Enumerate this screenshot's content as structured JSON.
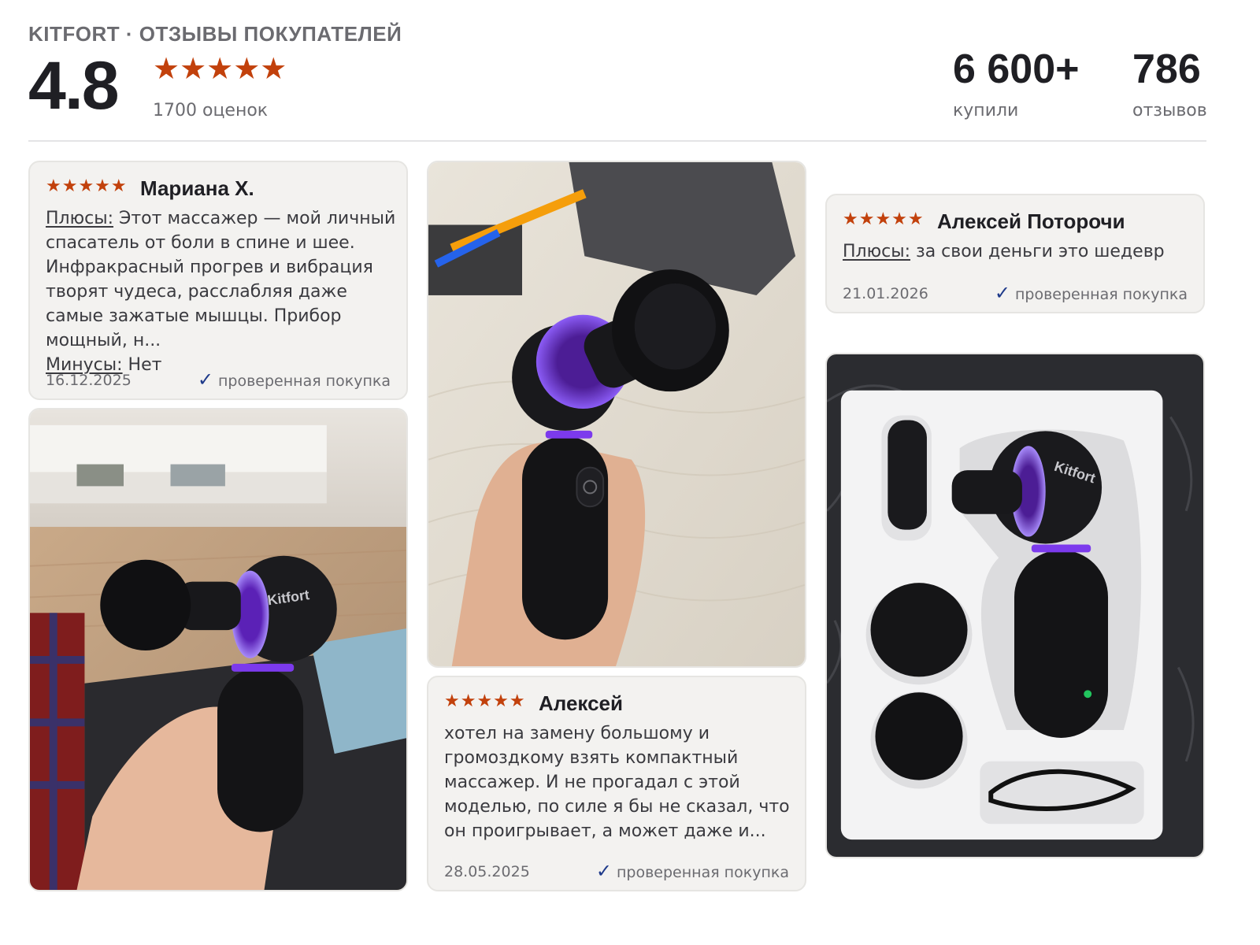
{
  "header": {
    "brand": "KITFORT · ОТЗЫВЫ ПОКУПАТЕЛЕЙ",
    "rating": "4.8",
    "stars": "★★★★★",
    "ratings_count": "1700 оценок",
    "bought_value": "6 600+",
    "bought_label": "купили",
    "reviews_value": "786",
    "reviews_label": "отзывов"
  },
  "reviews": [
    {
      "stars": "★★★★★",
      "author": "Мариана Х.",
      "pros_label": "Плюсы:",
      "pros_text": " Этот массажер — мой личный спасатель от боли в спине и шее. Инфракрасный прогрев и вибрация творят чудеса, расслабляя даже самые зажатые мышцы. Прибор мощный, н...",
      "cons_label": "Минусы:",
      "cons_text": " Нет",
      "date": "16.12.2025",
      "verified": "проверенная покупка"
    },
    {
      "stars": "★★★★★",
      "author": "Алексей Поторочи",
      "pros_label": "Плюсы:",
      "pros_text": " за свои деньги это шедевр",
      "date": "21.01.2026",
      "verified": "проверенная покупка"
    },
    {
      "stars": "★★★★★",
      "author": "Алексей",
      "text": "хотел на замену большому и громоздкому взять компактный массажер. И не прогадал с этой моделью, по силе я бы не сказал, что он проигрывает, а может даже и...",
      "date": "28.05.2025",
      "verified": "проверенная покупка"
    }
  ],
  "photos": [
    {
      "subject": "massager-in-hand-room",
      "label": "Kitfort"
    },
    {
      "subject": "massager-flat-head-in-hand"
    },
    {
      "subject": "massager-in-box-with-attachments",
      "label": "Kitfort"
    }
  ],
  "colors": {
    "star": "#c2410c",
    "card_bg": "#f3f2f0",
    "accent_purple": "#7c3aed",
    "check": "#1e3a8a"
  }
}
